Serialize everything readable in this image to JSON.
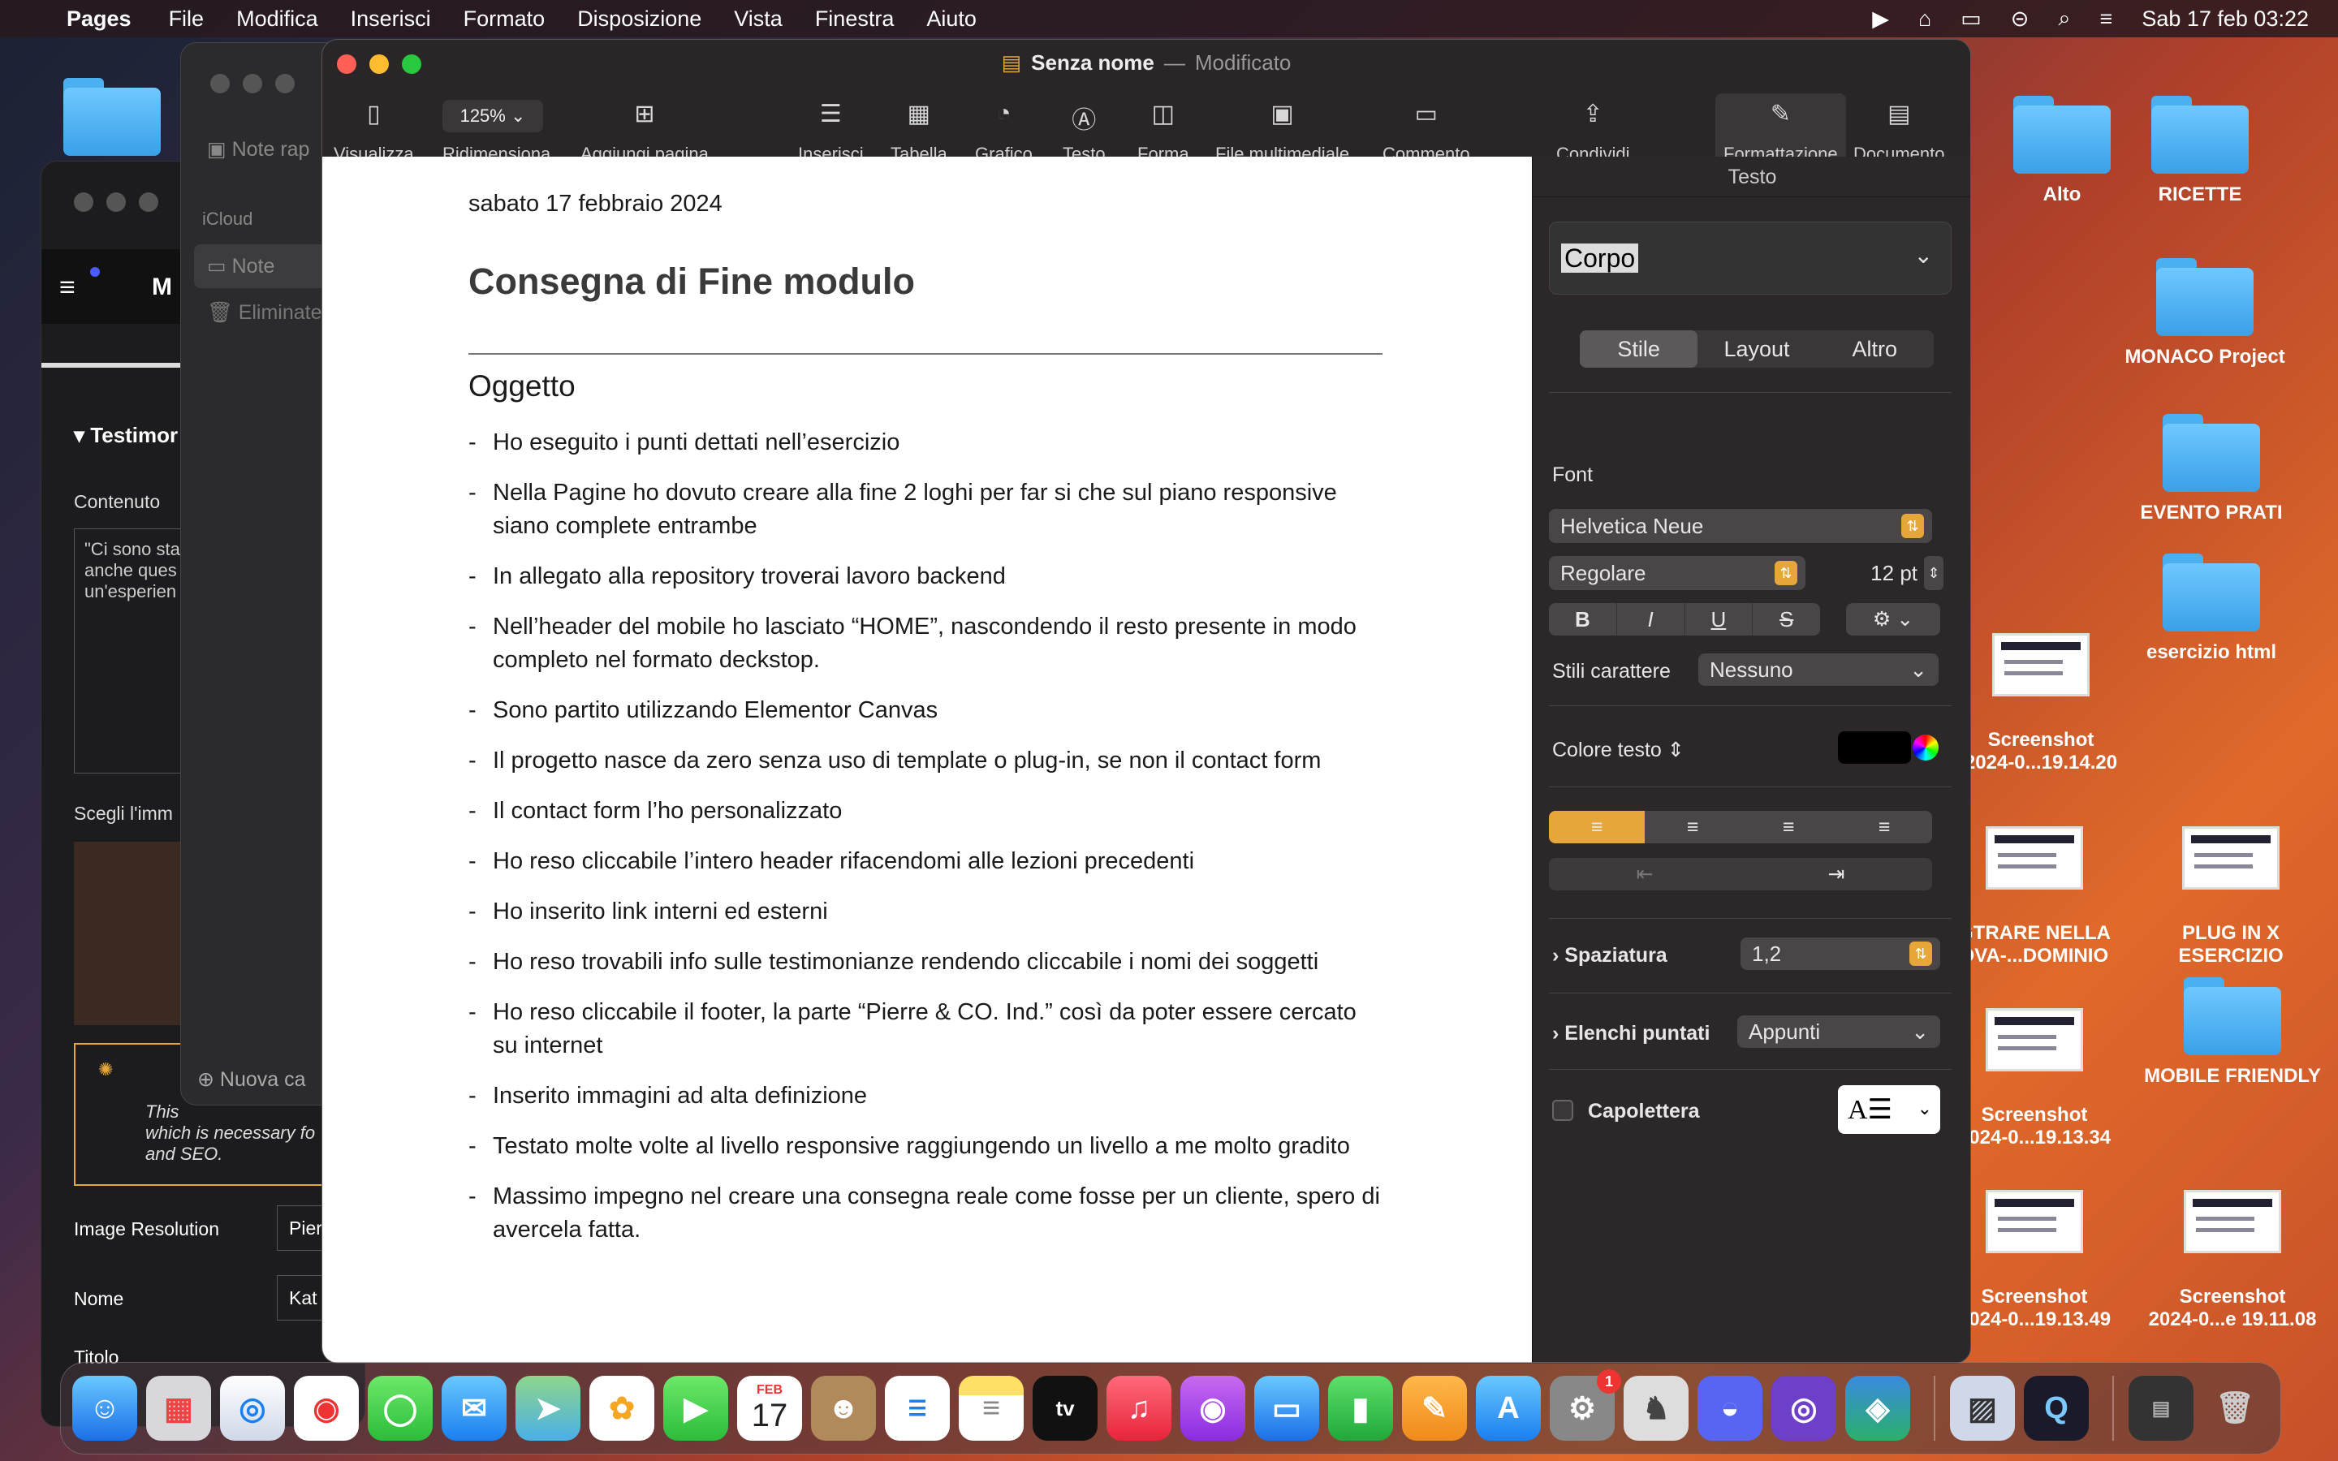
{
  "menubar": {
    "app": "Pages",
    "items": [
      "File",
      "Modifica",
      "Inserisci",
      "Formato",
      "Disposizione",
      "Vista",
      "Finestra",
      "Aiuto"
    ],
    "clock": "Sab 17 feb  03:22"
  },
  "desktop": {
    "folders": [
      {
        "label": "Alto"
      },
      {
        "label": "RICETTE"
      },
      {
        "label": "MONACO Project"
      },
      {
        "label": "EVENTO PRATI"
      },
      {
        "label": "esercizio html"
      },
      {
        "label": "MOBILE FRIENDLY"
      }
    ],
    "files": [
      {
        "label": "Screenshot\n2024-0...19.14.20"
      },
      {
        "label": "GTRARE NELLA\nDVA-...DOMINIO"
      },
      {
        "label": "PLUG IN X\nESERCIZIO"
      },
      {
        "label": "Screenshot\n2024-0...19.13.34"
      },
      {
        "label": "Screenshot\n2024-0...19.13.49"
      },
      {
        "label": "Screenshot\n2024-0...e 19.11.08"
      }
    ]
  },
  "bg_window_1": {
    "section": "Testimor",
    "content_label": "Contenuto",
    "content_text": "\"Ci sono sta\nanche ques\nun'esperien",
    "image_label": "Scegli l'imm",
    "notice": "This\nwhich is necessary fo\nand SEO.",
    "image_resolution_label": "Image Resolution",
    "image_resolution_value": "Pier",
    "name_label": "Nome",
    "name_value": "Kat",
    "title_label": "Titolo"
  },
  "notes_window": {
    "header": "Note rap",
    "section": "iCloud",
    "folders": [
      "Note",
      "Eliminate"
    ],
    "new_folder": "Nuova ca"
  },
  "pages": {
    "window_title": "Senza nome",
    "status": "Modificato",
    "toolbar": {
      "view": "Visualizza",
      "zoom_value": "125%",
      "zoom": "Ridimensiona",
      "add_page": "Aggiungi pagina",
      "insert": "Inserisci",
      "table": "Tabella",
      "chart": "Grafico",
      "text": "Testo",
      "shape": "Forma",
      "media": "File multimediale",
      "comment": "Commento",
      "share": "Condividi",
      "format": "Formattazione",
      "document": "Documento"
    },
    "document": {
      "date": "sabato 17 febbraio 2024",
      "title": "Consegna di Fine modulo",
      "subject": "Oggetto",
      "items": [
        "Ho eseguito i punti dettati nell’esercizio",
        "Nella Pagine ho dovuto creare alla fine 2 loghi per far si che sul piano responsive siano complete entrambe",
        "In allegato alla repository troverai lavoro backend",
        "Nell’header del mobile ho lasciato “HOME”, nascondendo il resto presente in modo completo nel formato deckstop.",
        "Sono partito utilizzando Elementor Canvas",
        "Il progetto nasce da zero senza uso di template o plug-in, se non il contact form",
        "Il contact form l’ho personalizzato",
        "Ho reso cliccabile l’intero header rifacendomi alle lezioni precedenti",
        "Ho inserito link interni ed esterni",
        "Ho reso trovabili info sulle testimonianze rendendo cliccabile i nomi dei soggetti",
        "Ho reso cliccabile il footer, la parte “Pierre & CO. Ind.” così da poter essere cercato su internet",
        "Inserito immagini ad alta definizione",
        "Testato molte volte al livello responsive raggiungendo un livello a me molto gradito",
        "Massimo impegno nel creare una consegna reale come fosse per un cliente, spero di avercela fatta."
      ]
    },
    "inspector": {
      "header": "Testo",
      "paragraph_style": "Corpo",
      "tabs": [
        "Stile",
        "Layout",
        "Altro"
      ],
      "font_label": "Font",
      "font_family": "Helvetica Neue",
      "font_style": "Regolare",
      "font_size": "12 pt",
      "format_buttons": [
        "B",
        "I",
        "U",
        "S"
      ],
      "char_styles_label": "Stili carattere",
      "char_styles_value": "Nessuno",
      "text_color_label": "Colore testo",
      "spacing_label": "Spaziatura",
      "spacing_value": "1,2",
      "bullets_label": "Elenchi puntati",
      "bullets_value": "Appunti",
      "dropcap_label": "Capolettera"
    }
  },
  "dock": {
    "calendar_month": "FEB",
    "calendar_day": "17",
    "appletv": "tv",
    "badge": "1"
  },
  "colors": {
    "accent": "#e6a63a",
    "close": "#ff5f57",
    "minimize": "#febc2e",
    "zoom": "#28c840"
  }
}
